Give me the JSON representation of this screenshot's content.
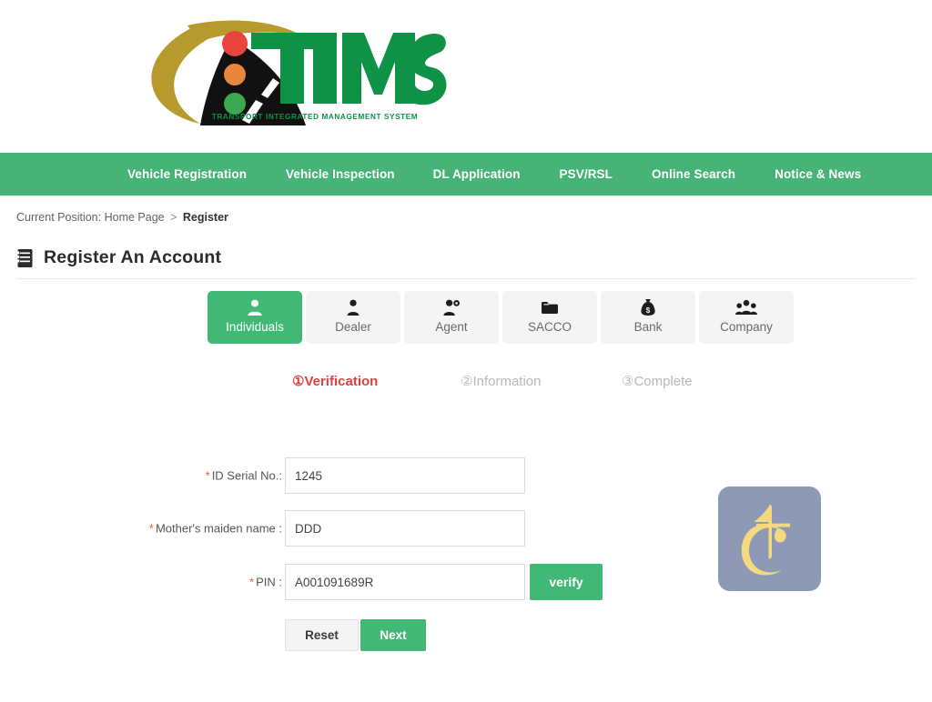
{
  "brand": {
    "logo_text": "TIMS",
    "logo_tagline": "TRANSPORT INTEGRATED MANAGEMENT SYSTEM",
    "logo_text_color": "#0f9246",
    "logo_arc_color": "#b79a2d",
    "traffic_light_colors": [
      "#e8453c",
      "#e8863c",
      "#3da84f"
    ]
  },
  "nav": {
    "background": "#48b377",
    "items": [
      {
        "label": "Vehicle Registration"
      },
      {
        "label": "Vehicle Inspection"
      },
      {
        "label": "DL Application"
      },
      {
        "label": "PSV/RSL"
      },
      {
        "label": "Online Search"
      },
      {
        "label": "Notice & News"
      }
    ]
  },
  "breadcrumb": {
    "prefix": "Current Position:",
    "home": "Home Page",
    "separator": ">",
    "current": "Register"
  },
  "header": {
    "title": "Register An Account",
    "icon": "document-icon"
  },
  "tabs": {
    "active_index": 0,
    "active_color": "#42b877",
    "items": [
      {
        "label": "Individuals",
        "icon": "person-icon"
      },
      {
        "label": "Dealer",
        "icon": "person-tie-icon"
      },
      {
        "label": "Agent",
        "icon": "person-gear-icon"
      },
      {
        "label": "SACCO",
        "icon": "folder-icon"
      },
      {
        "label": "Bank",
        "icon": "money-bag-icon"
      },
      {
        "label": "Company",
        "icon": "people-group-icon"
      }
    ]
  },
  "steps": {
    "active_color": "#e0413c",
    "inactive_color": "#b8b8b8",
    "items": [
      {
        "label": "①Verification",
        "state": "active"
      },
      {
        "label": "②Information",
        "state": "inactive"
      },
      {
        "label": "③Complete",
        "state": "inactive"
      }
    ]
  },
  "form": {
    "required_marker": "*",
    "fields": [
      {
        "label": "ID Serial No.:",
        "value": "1245",
        "placeholder": ""
      },
      {
        "label": "Mother's maiden name :",
        "value": "DDD",
        "placeholder": ""
      },
      {
        "label": "PIN :",
        "value": "A001091689R",
        "placeholder": ""
      }
    ],
    "verify_label": "verify",
    "reset_label": "Reset",
    "next_label": "Next"
  },
  "side_badge": {
    "icon": "monogram-tc-icon",
    "background": "#8e9ab5",
    "glyph_color": "#f5d97e"
  }
}
